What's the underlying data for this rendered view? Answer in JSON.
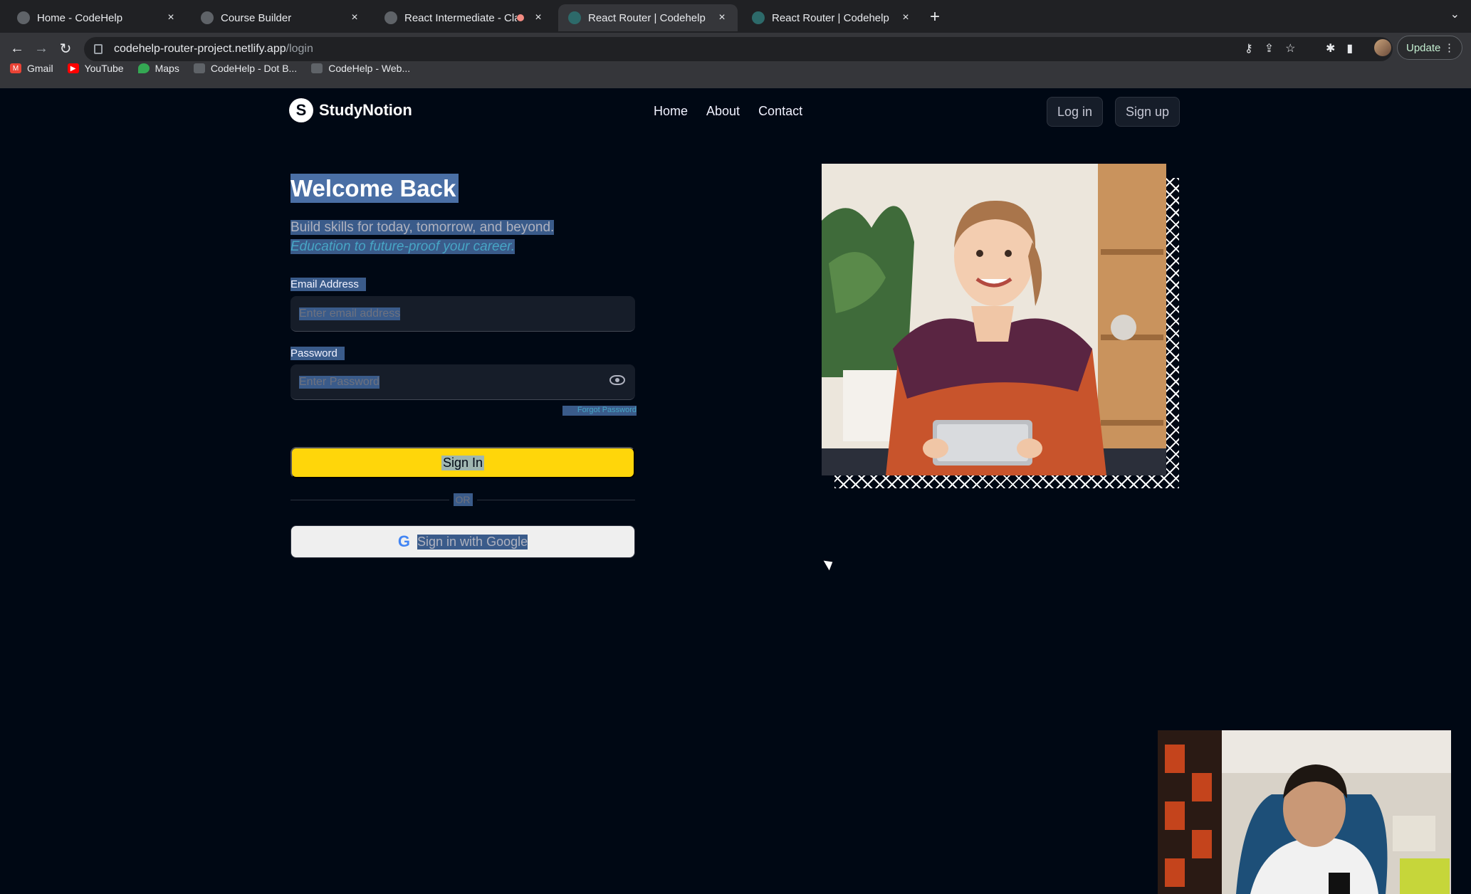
{
  "browser": {
    "tabs": [
      {
        "title": "Home - CodeHelp",
        "active": false
      },
      {
        "title": "Course Builder",
        "active": false
      },
      {
        "title": "React Intermediate - Class",
        "active": false,
        "recording": true
      },
      {
        "title": "React Router | Codehelp",
        "active": true
      },
      {
        "title": "React Router | Codehelp",
        "active": false
      }
    ],
    "new_tab_icon": "plus-icon",
    "url_host": "codehelp-router-project.netlify.app",
    "url_path": "/login",
    "update_label": "Update",
    "bookmarks": [
      {
        "label": "Gmail",
        "icon": "gmail-icon",
        "color": "#ea4335"
      },
      {
        "label": "YouTube",
        "icon": "youtube-icon",
        "color": "#ff0000"
      },
      {
        "label": "Maps",
        "icon": "maps-icon",
        "color": "#34a853"
      },
      {
        "label": "CodeHelp - Dot B...",
        "icon": "codehelp-icon",
        "color": "#5f6368"
      },
      {
        "label": "CodeHelp - Web...",
        "icon": "codehelp-icon",
        "color": "#5f6368"
      }
    ]
  },
  "site": {
    "logo_text": "StudyNotion",
    "nav": [
      "Home",
      "About",
      "Contact"
    ],
    "login_label": "Log in",
    "signup_label": "Sign up"
  },
  "login": {
    "title": "Welcome Back",
    "desc1": "Build skills for today, tomorrow, and beyond.",
    "desc2": "Education to future-proof your career.",
    "email_label": "Email Address",
    "email_placeholder": "Enter email address",
    "password_label": "Password",
    "password_placeholder": "Enter Password",
    "forgot_label": "Forgot Password",
    "signin_label": "Sign In",
    "or_label": "OR",
    "google_label": "Sign in with Google"
  },
  "colors": {
    "page_bg": "#000814",
    "accent_yellow": "#ffd60a",
    "selection": "#3a5b8a"
  }
}
